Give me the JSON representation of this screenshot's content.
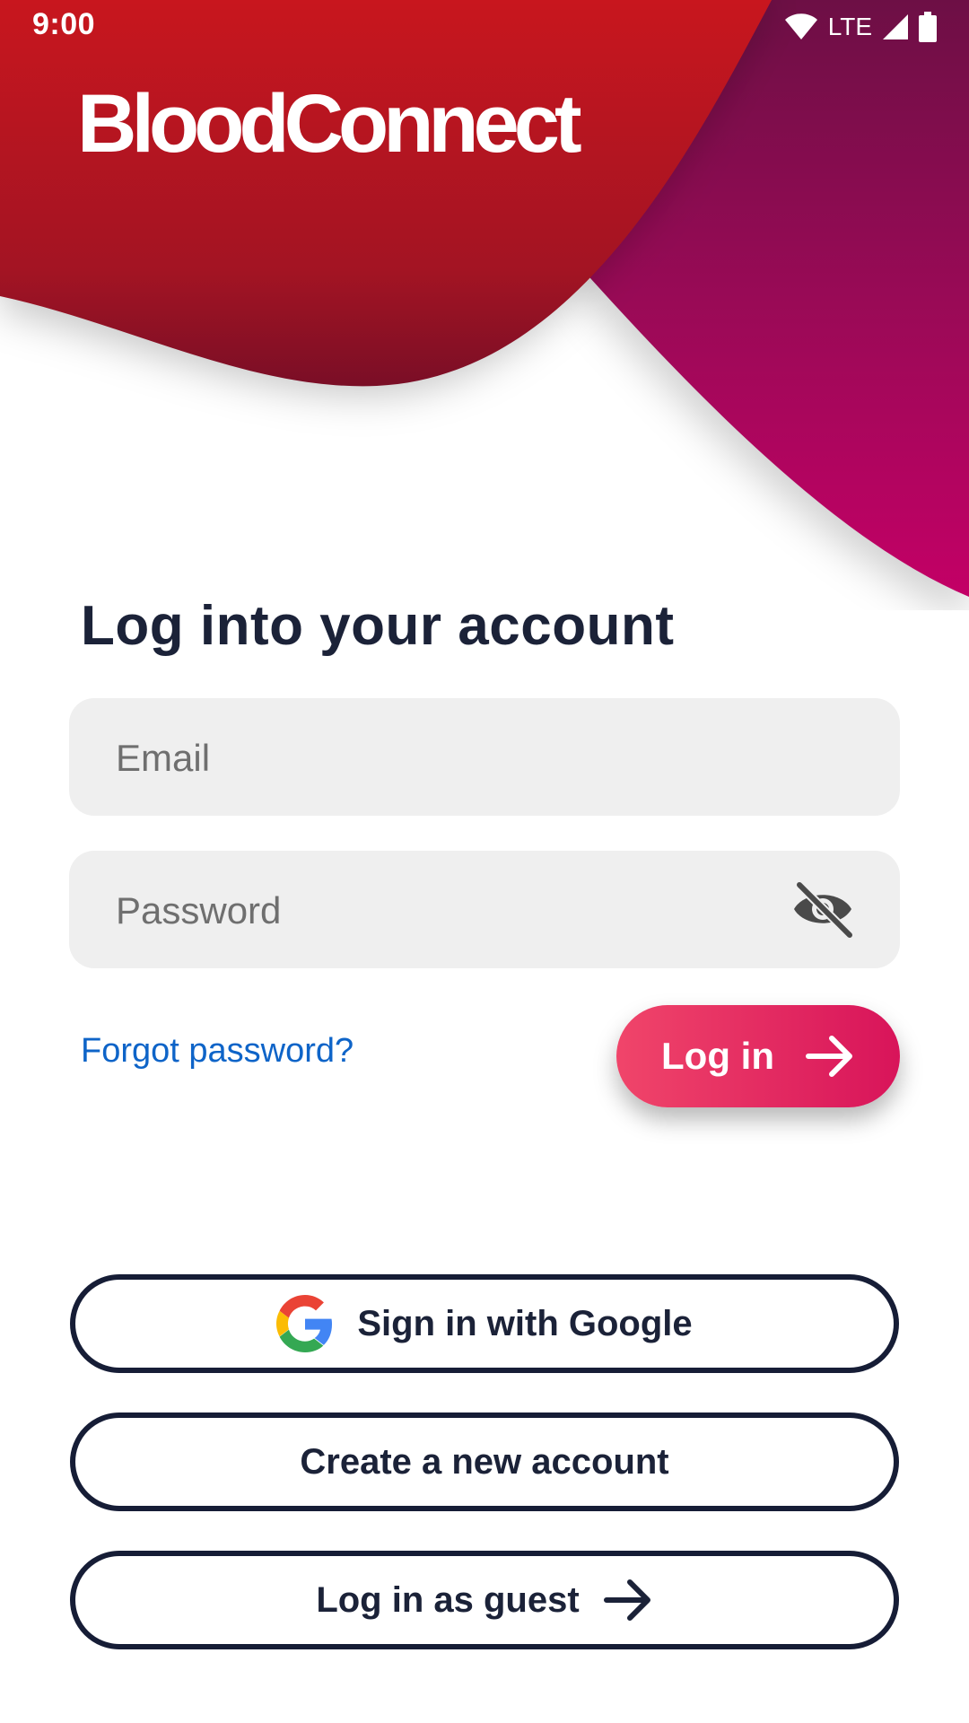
{
  "status_bar": {
    "time": "9:00",
    "network": "LTE"
  },
  "app": {
    "brand_name": "BloodConnect"
  },
  "login": {
    "heading": "Log into your account",
    "email_placeholder": "Email",
    "password_placeholder": "Password",
    "forgot_password": "Forgot password?",
    "login_label": "Log in"
  },
  "alt_actions": {
    "google_label": "Sign in with Google",
    "create_account_label": "Create a new account",
    "guest_label": "Log in as guest"
  },
  "colors": {
    "brand_red": "#c8161e",
    "brand_magenta": "#c30066",
    "login_button_gradient_start": "#f0456a",
    "login_button_gradient_end": "#d8145a",
    "text_dark": "#1b2238",
    "link_blue": "#0e64c8",
    "field_bg": "#efefef"
  },
  "icons": {
    "password_toggle": "eye-off-icon",
    "login_arrow": "arrow-right-icon",
    "google": "google-g-icon",
    "guest_arrow": "arrow-right-icon"
  }
}
